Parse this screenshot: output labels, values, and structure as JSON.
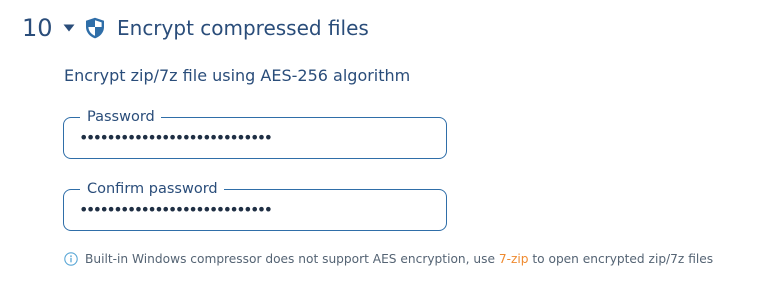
{
  "section": {
    "step_number": "10",
    "toggle_icon": "caret-down-icon",
    "icon": "shield-icon",
    "title": "Encrypt compressed files",
    "description": "Encrypt zip/7z file using AES-256 algorithm"
  },
  "fields": {
    "password": {
      "label": "Password",
      "value": "••••••••••••••••••••••••••••"
    },
    "confirm_password": {
      "label": "Confirm password",
      "value": "••••••••••••••••••••••••••••"
    }
  },
  "note": {
    "icon": "info-icon",
    "text_before": "Built-in Windows compressor does not support AES encryption, use ",
    "link_text": "7-zip",
    "text_after": " to open encrypted zip/7z files"
  },
  "colors": {
    "heading": "#2a4d7a",
    "field_border": "#2f6ea8",
    "link": "#ef8a2f",
    "info_icon": "#5aa7d6"
  }
}
